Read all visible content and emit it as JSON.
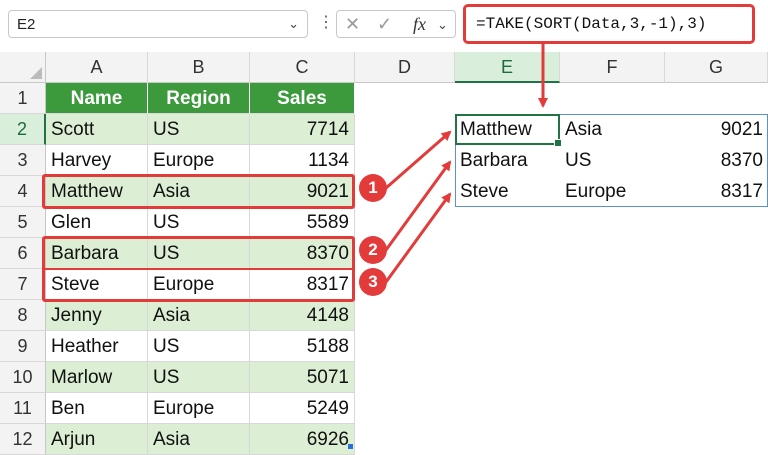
{
  "name_box": {
    "value": "E2"
  },
  "formula_bar": {
    "cancel_glyph": "✕",
    "enter_glyph": "✓",
    "fx_label": "fx",
    "formula": "=TAKE(SORT(Data,3,-1),3)"
  },
  "columns": [
    "A",
    "B",
    "C",
    "D",
    "E",
    "F",
    "G"
  ],
  "rows": [
    "1",
    "2",
    "3",
    "4",
    "5",
    "6",
    "7",
    "8",
    "9",
    "10",
    "11",
    "12"
  ],
  "table": {
    "headers": [
      "Name",
      "Region",
      "Sales"
    ],
    "rows": [
      [
        "Scott",
        "US",
        "7714"
      ],
      [
        "Harvey",
        "Europe",
        "1134"
      ],
      [
        "Matthew",
        "Asia",
        "9021"
      ],
      [
        "Glen",
        "US",
        "5589"
      ],
      [
        "Barbara",
        "US",
        "8370"
      ],
      [
        "Steve",
        "Europe",
        "8317"
      ],
      [
        "Jenny",
        "Asia",
        "4148"
      ],
      [
        "Heather",
        "US",
        "5188"
      ],
      [
        "Marlow",
        "US",
        "5071"
      ],
      [
        "Ben",
        "Europe",
        "5249"
      ],
      [
        "Arjun",
        "Asia",
        "6926"
      ]
    ]
  },
  "result": [
    [
      "Matthew",
      "Asia",
      "9021"
    ],
    [
      "Barbara",
      "US",
      "8370"
    ],
    [
      "Steve",
      "Europe",
      "8317"
    ]
  ],
  "badges": [
    "1",
    "2",
    "3"
  ],
  "colors": {
    "header_fill": "#3c9a3c",
    "band_fill": "#dcefd4",
    "highlight_red": "#e33a3a",
    "selection_green": "#217346"
  }
}
